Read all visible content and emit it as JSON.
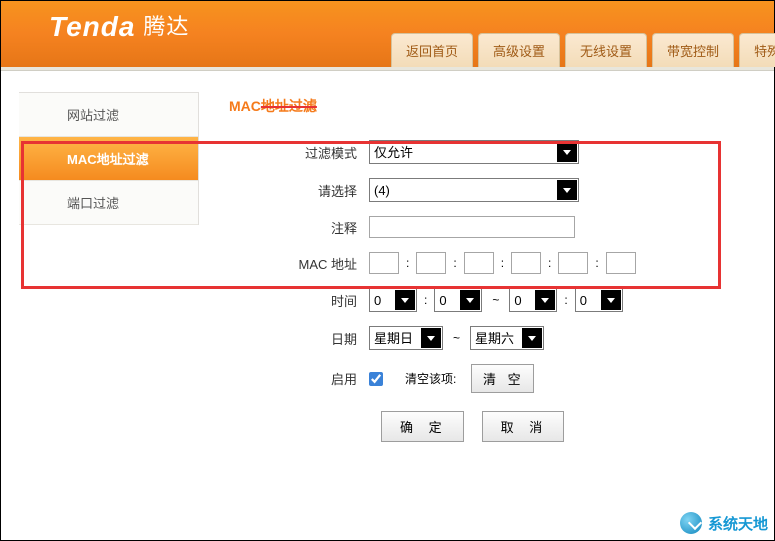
{
  "logo": {
    "brand": "Tenda",
    "sub": "腾达"
  },
  "topnav": [
    {
      "label": "返回首页"
    },
    {
      "label": "高级设置"
    },
    {
      "label": "无线设置"
    },
    {
      "label": "带宽控制"
    },
    {
      "label": "特殊"
    }
  ],
  "sidebar": {
    "items": [
      {
        "label": "网站过滤",
        "active": false
      },
      {
        "label": "MAC地址过滤",
        "active": true
      },
      {
        "label": "端口过滤",
        "active": false
      }
    ]
  },
  "page": {
    "title_plain": "MAC",
    "title_strike": "地址过滤"
  },
  "form": {
    "filter_mode": {
      "label": "过滤模式",
      "value": "仅允许"
    },
    "select_item": {
      "label": "请选择",
      "value": "(4)"
    },
    "comment": {
      "label": "注释",
      "value": ""
    },
    "mac": {
      "label": "MAC 地址",
      "segs": [
        "",
        "",
        "",
        "",
        "",
        ""
      ]
    },
    "time": {
      "label": "时间",
      "from_h": "0",
      "from_m": "0",
      "to_h": "0",
      "to_m": "0"
    },
    "day": {
      "label": "日期",
      "from": "星期日",
      "to": "星期六"
    },
    "enable": {
      "label": "启用",
      "checked": true
    },
    "clear": {
      "label": "清空该项:",
      "button": "清 空"
    }
  },
  "buttons": {
    "ok": "确 定",
    "cancel": "取 消"
  },
  "watermark": "系统天地"
}
